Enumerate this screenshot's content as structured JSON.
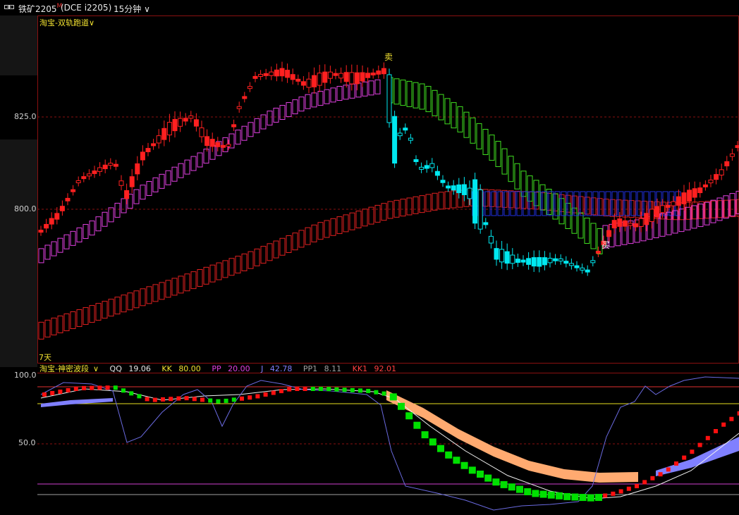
{
  "window": {
    "symbol": "铁矿2205",
    "symbol_mark": "M",
    "contract": "(DCE  i2205)",
    "period": "15分钟",
    "period_chevron": "∨"
  },
  "main_panel": {
    "indicator": "淘宝-双轨跑道",
    "chevron": "∨",
    "sell_marker": "卖",
    "buy_marker": "买",
    "days_label": "7天",
    "y_ticks": [
      "825.0",
      "800.0"
    ]
  },
  "sub_panel": {
    "indicator": "淘宝-神密波段",
    "chevron": "∨",
    "readouts": [
      {
        "label": "QQ",
        "value": "19.06",
        "color": "#e6e6e6"
      },
      {
        "label": "KK",
        "value": "80.00",
        "color": "#f0e030"
      },
      {
        "label": "PP",
        "value": "20.00",
        "color": "#e040e0"
      },
      {
        "label": "J",
        "value": "42.78",
        "color": "#8080ff"
      },
      {
        "label": "PP1",
        "value": "8.11",
        "color": "#a0a0a0"
      },
      {
        "label": "KK1",
        "value": "92.01",
        "color": "#ff4040"
      }
    ],
    "y_ticks": [
      "100.0",
      "50.0"
    ]
  },
  "colors": {
    "bull": "#ff2020",
    "bear": "#00e8f0",
    "upper_track": "#e040e0",
    "lower_track": "#e02020",
    "green_track": "#40e020",
    "blue_track": "#2030e0",
    "grid": "#8a1010"
  }
}
